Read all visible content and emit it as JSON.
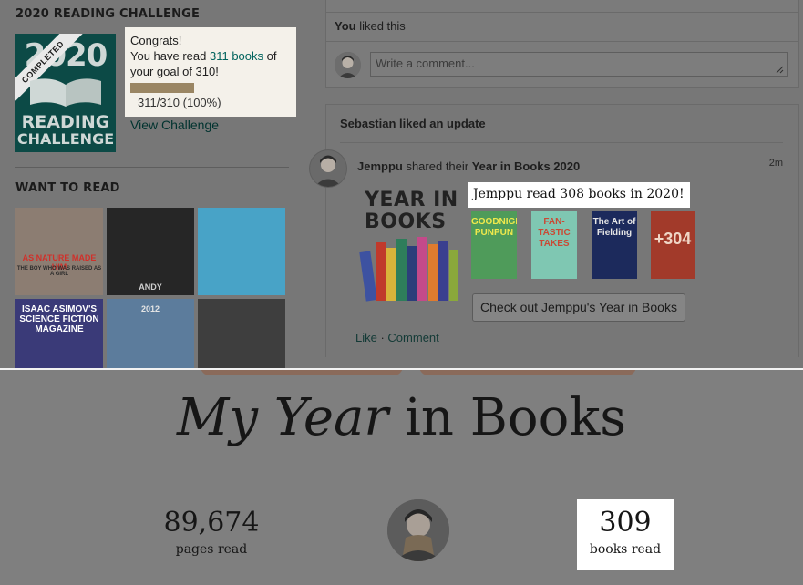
{
  "sidebar": {
    "challenge_heading": "2020 READING CHALLENGE",
    "badge": {
      "year": "2020",
      "ribbon": "COMPLETED",
      "line1": "READING",
      "line2": "CHALLENGE"
    },
    "congrats": {
      "line1": "Congrats!",
      "read_prefix": "You have read ",
      "books_link": "311 books",
      "read_suffix": " of",
      "goal_line": "your goal of 310!",
      "progress_text": "311/310 (100%)",
      "progress_fraction": 1.0
    },
    "view_challenge": "View Challenge",
    "want_to_read_heading": "WANT TO READ",
    "covers": [
      {
        "title": "AS NATURE MADE HIM",
        "subtitle": "THE BOY WHO WAS RAISED AS A GIRL",
        "bg": "#8c7d72",
        "fg": "#d0302a"
      },
      {
        "title": "ANDY",
        "subtitle": "",
        "bg": "#262626",
        "fg": "#cfcfcf"
      },
      {
        "title": "",
        "subtitle": "",
        "bg": "#48a3c7",
        "fg": "#ffffff"
      },
      {
        "title": "ISAAC ASIMOV'S SCIENCE FICTION MAGAZINE",
        "subtitle": "",
        "bg": "#3a3a78",
        "fg": "#ffffff"
      },
      {
        "title": "2012",
        "subtitle": "",
        "bg": "#5c7c9c",
        "fg": "#e5e5e5"
      },
      {
        "title": "",
        "subtitle": "",
        "bg": "#3e3e3e",
        "fg": "#bdbdbd"
      }
    ]
  },
  "feed": {
    "you_liked_bold": "You",
    "you_liked_rest": " liked this",
    "comment_placeholder": "Write a comment...",
    "card_heading": "Sebastian liked an update",
    "actor_name": "Jemppu",
    "actor_action": " shared their ",
    "actor_object": "Year in Books 2020",
    "time": "2m",
    "yib_heading_line1": "YEAR IN",
    "yib_heading_line2": "BOOKS",
    "highlight": "Jemppu read 308 books in 2020!",
    "thumbs": [
      {
        "label": "GOODNIGHT PUNPUN",
        "bg": "#4f9b5a",
        "fg": "#f0e94c"
      },
      {
        "label": "FAN-TASTIC TAKES",
        "bg": "#7fc7b2",
        "fg": "#c94a35"
      },
      {
        "label": "The Art of Fielding",
        "bg": "#1c2a5c",
        "fg": "#e6e6e6"
      },
      {
        "label": "+304",
        "bg": "#a23a2a",
        "fg": "#f0d6c6"
      }
    ],
    "cta_button": "Check out Jemppu's Year in Books",
    "like_link": "Like",
    "separator": " · ",
    "comment_link": "Comment"
  },
  "year_in_books": {
    "title_italic": "My Year",
    "title_rest": " in Books",
    "pages_value": "89,674",
    "pages_label": "pages read",
    "books_value": "309",
    "books_label": "books read"
  },
  "colors": {
    "accent_teal": "#00635d",
    "badge_teal": "#0c4a46",
    "progress_tan": "#9a8664",
    "dim_overlay": "#777777"
  }
}
